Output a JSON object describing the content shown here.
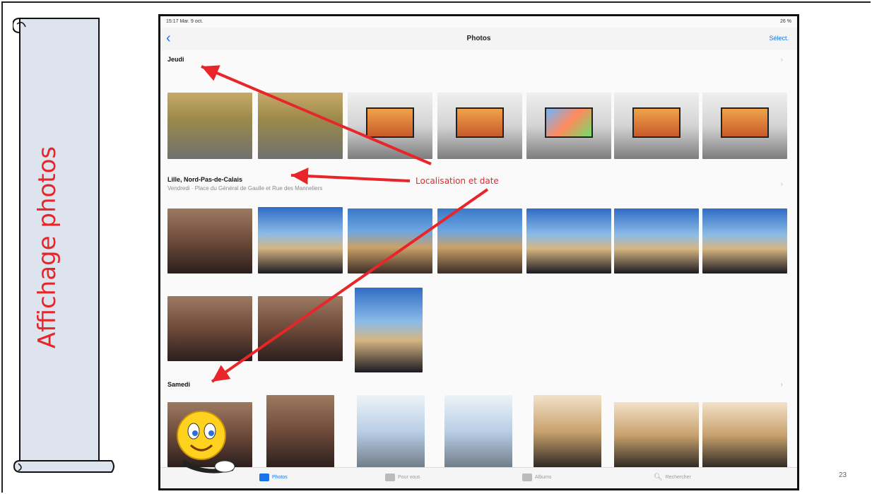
{
  "slide": {
    "title": "Affichage photos",
    "page_number": "23"
  },
  "statusbar": {
    "time": "15:17  Mar. 9 oct.",
    "battery": "26 %"
  },
  "navbar": {
    "back_icon": "chevron-left-icon",
    "title": "Photos",
    "select_label": "Sélect."
  },
  "sections": [
    {
      "title": "Jeudi",
      "subtitle": ""
    },
    {
      "title": "Lille, Nord-Pas-de-Calais",
      "subtitle": "Vendredi  ·  Place du Général de Gaulle et Rue des Manneliers"
    },
    {
      "title": "Samedi",
      "subtitle": ""
    }
  ],
  "annotation": {
    "label": "Localisation et date",
    "color": "#e8262a"
  },
  "tabbar": {
    "tabs": [
      {
        "label": "Photos",
        "icon": "photos-icon",
        "active": true
      },
      {
        "label": "Pour vous",
        "icon": "for-you-icon",
        "active": false
      },
      {
        "label": "Albums",
        "icon": "albums-icon",
        "active": false
      },
      {
        "label": "Rechercher",
        "icon": "search-icon",
        "active": false
      }
    ]
  },
  "colors": {
    "accent": "#1a73e8",
    "annotation": "#e8262a",
    "title": "#e8262a"
  }
}
